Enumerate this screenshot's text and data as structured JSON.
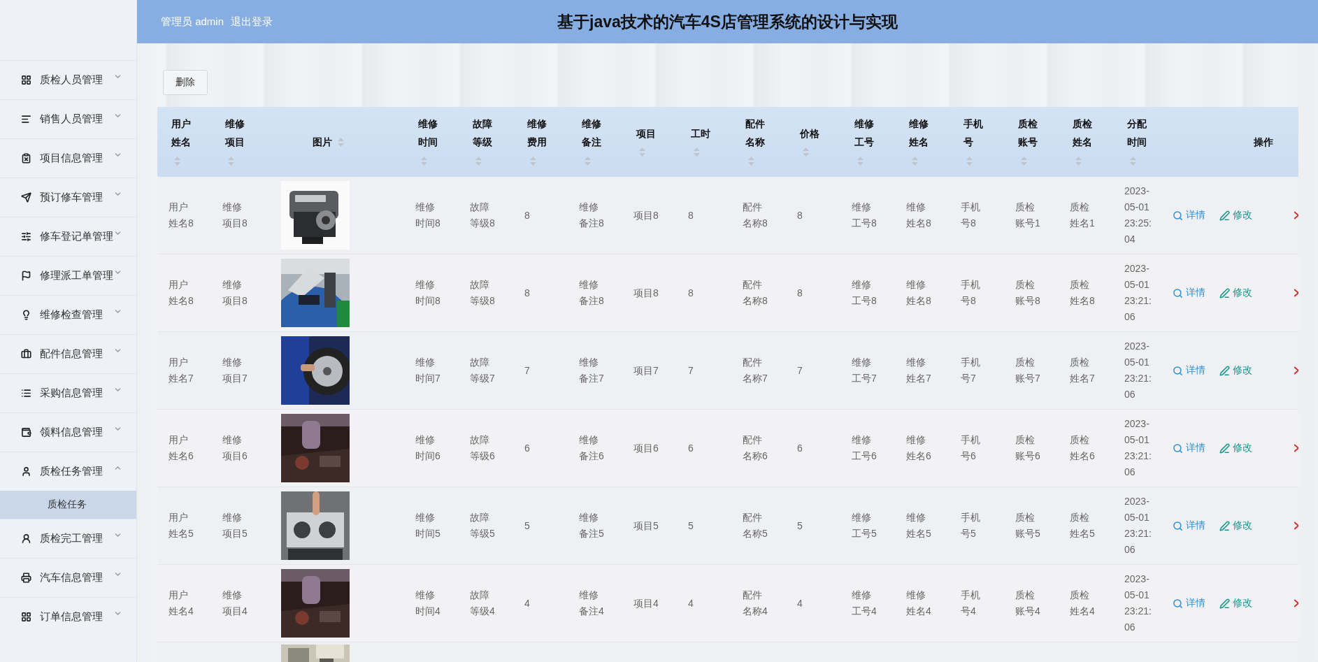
{
  "header": {
    "user": "管理员 admin",
    "logout": "退出登录",
    "title": "基于java技术的汽车4S店管理系统的设计与实现"
  },
  "sidebar": {
    "items": [
      {
        "label": "质检人员管理",
        "expanded": false
      },
      {
        "label": "销售人员管理",
        "expanded": false
      },
      {
        "label": "项目信息管理",
        "expanded": false
      },
      {
        "label": "预订修车管理",
        "expanded": false
      },
      {
        "label": "修车登记单管理",
        "expanded": false
      },
      {
        "label": "修理派工单管理",
        "expanded": false
      },
      {
        "label": "维修检查管理",
        "expanded": false
      },
      {
        "label": "配件信息管理",
        "expanded": false
      },
      {
        "label": "采购信息管理",
        "expanded": false
      },
      {
        "label": "领料信息管理",
        "expanded": false
      },
      {
        "label": "质检任务管理",
        "expanded": true,
        "children": [
          {
            "label": "质检任务",
            "selected": true
          }
        ]
      },
      {
        "label": "质检完工管理",
        "expanded": false
      },
      {
        "label": "汽车信息管理",
        "expanded": false
      },
      {
        "label": "订单信息管理",
        "expanded": false
      }
    ]
  },
  "toolbar": {
    "delete_button": "删除"
  },
  "table": {
    "columns": [
      {
        "label": "用户姓名",
        "kind": "text"
      },
      {
        "label": "维修项目",
        "kind": "text"
      },
      {
        "label": "图片",
        "kind": "picture"
      },
      {
        "label": "维修时间",
        "kind": "text"
      },
      {
        "label": "故障等级",
        "kind": "text"
      },
      {
        "label": "维修费用",
        "kind": "text"
      },
      {
        "label": "维修备注",
        "kind": "text"
      },
      {
        "label": "项目",
        "kind": "text"
      },
      {
        "label": "工时",
        "kind": "text"
      },
      {
        "label": "配件名称",
        "kind": "text"
      },
      {
        "label": "价格",
        "kind": "text"
      },
      {
        "label": "维修工号",
        "kind": "text"
      },
      {
        "label": "维修姓名",
        "kind": "text"
      },
      {
        "label": "手机号",
        "kind": "text"
      },
      {
        "label": "质检账号",
        "kind": "text"
      },
      {
        "label": "质检姓名",
        "kind": "text"
      },
      {
        "label": "分配时间",
        "kind": "text"
      },
      {
        "label": "操作",
        "kind": "actions"
      }
    ],
    "rows": [
      {
        "cells": [
          "用户姓名8",
          "维修项目8",
          "",
          "维修时间8",
          "故障等级8",
          "8",
          "维修备注8",
          "项目8",
          "8",
          "配件名称8",
          "8",
          "维修工号8",
          "维修姓名8",
          "手机号8",
          "质检账号1",
          "质检姓名1",
          "2023-05-01 23:25:04"
        ],
        "actions": [
          "详情",
          "修改"
        ]
      },
      {
        "cells": [
          "用户姓名8",
          "维修项目8",
          "",
          "维修时间8",
          "故障等级8",
          "8",
          "维修备注8",
          "项目8",
          "8",
          "配件名称8",
          "8",
          "维修工号8",
          "维修姓名8",
          "手机号8",
          "质检账号8",
          "质检姓名8",
          "2023-05-01 23:21:06"
        ],
        "actions": [
          "详情",
          "修改"
        ]
      },
      {
        "cells": [
          "用户姓名7",
          "维修项目7",
          "",
          "维修时间7",
          "故障等级7",
          "7",
          "维修备注7",
          "项目7",
          "7",
          "配件名称7",
          "7",
          "维修工号7",
          "维修姓名7",
          "手机号7",
          "质检账号7",
          "质检姓名7",
          "2023-05-01 23:21:06"
        ],
        "actions": [
          "详情",
          "修改"
        ]
      },
      {
        "cells": [
          "用户姓名6",
          "维修项目6",
          "",
          "维修时间6",
          "故障等级6",
          "6",
          "维修备注6",
          "项目6",
          "6",
          "配件名称6",
          "6",
          "维修工号6",
          "维修姓名6",
          "手机号6",
          "质检账号6",
          "质检姓名6",
          "2023-05-01 23:21:06"
        ],
        "actions": [
          "详情",
          "修改"
        ]
      },
      {
        "cells": [
          "用户姓名5",
          "维修项目5",
          "",
          "维修时间5",
          "故障等级5",
          "5",
          "维修备注5",
          "项目5",
          "5",
          "配件名称5",
          "5",
          "维修工号5",
          "维修姓名5",
          "手机号5",
          "质检账号5",
          "质检姓名5",
          "2023-05-01 23:21:06"
        ],
        "actions": [
          "详情",
          "修改"
        ]
      },
      {
        "cells": [
          "用户姓名4",
          "维修项目4",
          "",
          "维修时间4",
          "故障等级4",
          "4",
          "维修备注4",
          "项目4",
          "4",
          "配件名称4",
          "4",
          "维修工号4",
          "维修姓名4",
          "手机号4",
          "质检账号4",
          "质检姓名4",
          "2023-05-01 23:21:06"
        ],
        "actions": [
          "详情",
          "修改"
        ]
      }
    ],
    "more_rows_below": true
  }
}
